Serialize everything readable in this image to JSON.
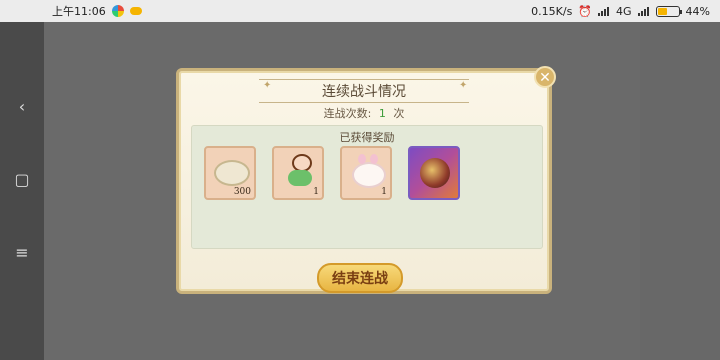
{
  "statusbar": {
    "time": "上午11:06",
    "network_speed": "0.15K/s",
    "network_type": "4G",
    "battery": "44%",
    "battery_level": 0.44
  },
  "navbar": {
    "back_icon": "‹",
    "home_icon": "▢",
    "menu_icon": "≡"
  },
  "dialog": {
    "title": "连续战斗情况",
    "battle_count_label": "连战次数:",
    "battle_count_value": "1",
    "battle_count_unit": "次",
    "rewards_title": "已获得奖励",
    "rewards": [
      {
        "qty": "300"
      },
      {
        "qty": "1"
      },
      {
        "qty": "1"
      },
      {
        "qty": ""
      }
    ],
    "end_button_label": "结束连战",
    "close_icon": "✕"
  }
}
